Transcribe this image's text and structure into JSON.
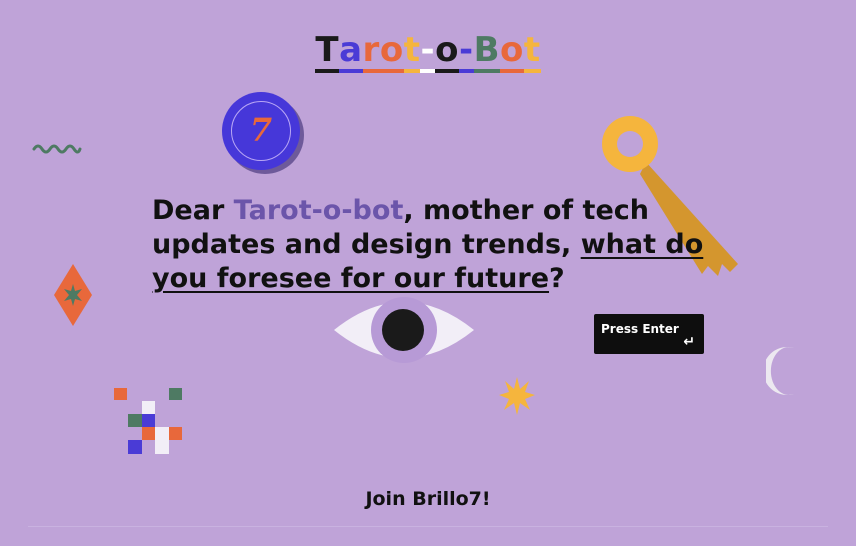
{
  "logo": {
    "letters": [
      {
        "ch": "T",
        "color": "#1a1a1a"
      },
      {
        "ch": "a",
        "color": "#4a3bd6"
      },
      {
        "ch": "r",
        "color": "#e8683b"
      },
      {
        "ch": "o",
        "color": "#e8683b"
      },
      {
        "ch": "t",
        "color": "#f5b53d"
      },
      {
        "ch": "-",
        "color": "#ffffff"
      },
      {
        "ch": "o",
        "color": "#1a1a1a"
      },
      {
        "ch": "-",
        "color": "#4a3bd6"
      },
      {
        "ch": "B",
        "color": "#4e7a63"
      },
      {
        "ch": "o",
        "color": "#e8683b"
      },
      {
        "ch": "t",
        "color": "#f5b53d"
      }
    ]
  },
  "coin": {
    "number": "7"
  },
  "headline": {
    "part1": "Dear ",
    "highlight": "Tarot-o-bot",
    "part2": ", mother of tech updates and design trends, ",
    "question": "what do you foresee for our future",
    "end": "?"
  },
  "press_enter": {
    "label": "Press Enter",
    "icon": "↵"
  },
  "footer": {
    "join_label": "Join Brillo7!"
  },
  "colors": {
    "background": "#bfa3d8",
    "accent_purple": "#4a3bd6",
    "accent_orange": "#e8683b",
    "accent_yellow": "#f5b53d",
    "accent_green": "#4e7a63"
  },
  "icons": [
    "squiggle-icon",
    "coin-seven-icon",
    "key-icon",
    "diamond-star-icon",
    "eye-icon",
    "sparkle-star-icon",
    "crescent-moon-icon",
    "pixel-mosaic-icon",
    "enter-arrow-icon"
  ]
}
